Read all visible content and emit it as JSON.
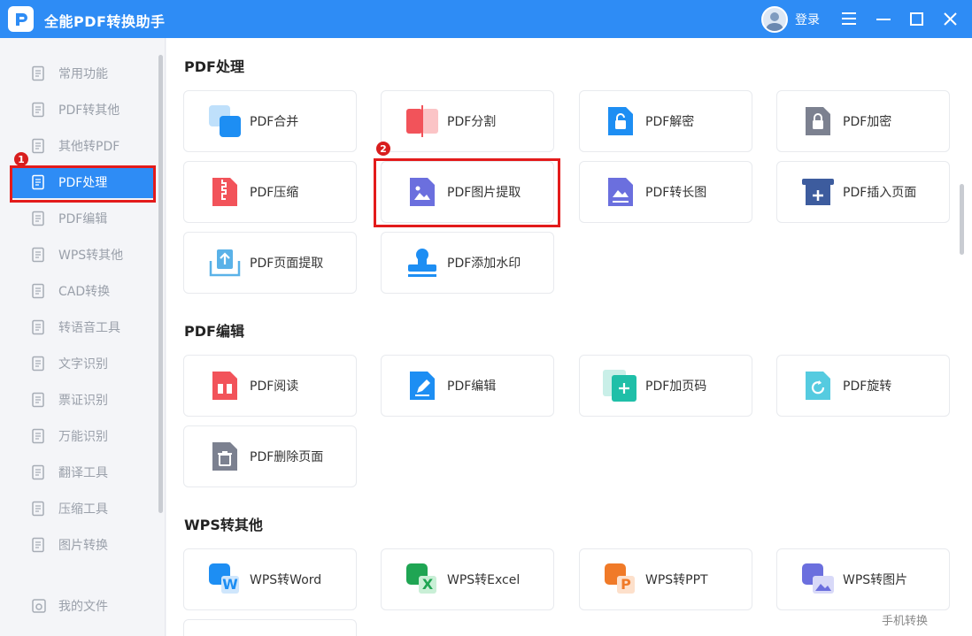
{
  "app": {
    "title": "全能PDF转换助手",
    "login": "登录"
  },
  "sidebar": {
    "items": [
      {
        "label": "常用功能",
        "icon": "common-tools-icon"
      },
      {
        "label": "PDF转其他",
        "icon": "pdf-to-other-icon"
      },
      {
        "label": "其他转PDF",
        "icon": "other-to-pdf-icon"
      },
      {
        "label": "PDF处理",
        "icon": "pdf-process-icon",
        "active": true
      },
      {
        "label": "PDF编辑",
        "icon": "pdf-edit-icon"
      },
      {
        "label": "WPS转其他",
        "icon": "wps-to-other-icon"
      },
      {
        "label": "CAD转换",
        "icon": "cad-convert-icon"
      },
      {
        "label": "转语音工具",
        "icon": "text-to-speech-icon"
      },
      {
        "label": "文字识别",
        "icon": "ocr-icon"
      },
      {
        "label": "票证识别",
        "icon": "ticket-recognition-icon"
      },
      {
        "label": "万能识别",
        "icon": "universal-recognition-icon"
      },
      {
        "label": "翻译工具",
        "icon": "translate-icon"
      },
      {
        "label": "压缩工具",
        "icon": "compress-tool-icon"
      },
      {
        "label": "图片转换",
        "icon": "image-convert-icon"
      }
    ],
    "my_files": "我的文件"
  },
  "sections": [
    {
      "title": "PDF处理",
      "cards": [
        "PDF合并",
        "PDF分割",
        "PDF解密",
        "PDF加密",
        "PDF压缩",
        "PDF图片提取",
        "PDF转长图",
        "PDF插入页面",
        "PDF页面提取",
        "PDF添加水印"
      ]
    },
    {
      "title": "PDF编辑",
      "cards": [
        "PDF阅读",
        "PDF编辑",
        "PDF加页码",
        "PDF旋转",
        "PDF删除页面"
      ]
    },
    {
      "title": "WPS转其他",
      "cards": [
        "WPS转Word",
        "WPS转Excel",
        "WPS转PPT",
        "WPS转图片"
      ]
    }
  ],
  "annotations": {
    "badge1": "1",
    "badge2": "2"
  },
  "footer": {
    "mobile_convert": "手机转换"
  },
  "colors": {
    "accent": "#2e8cf5",
    "highlight": "#e31b1b"
  }
}
